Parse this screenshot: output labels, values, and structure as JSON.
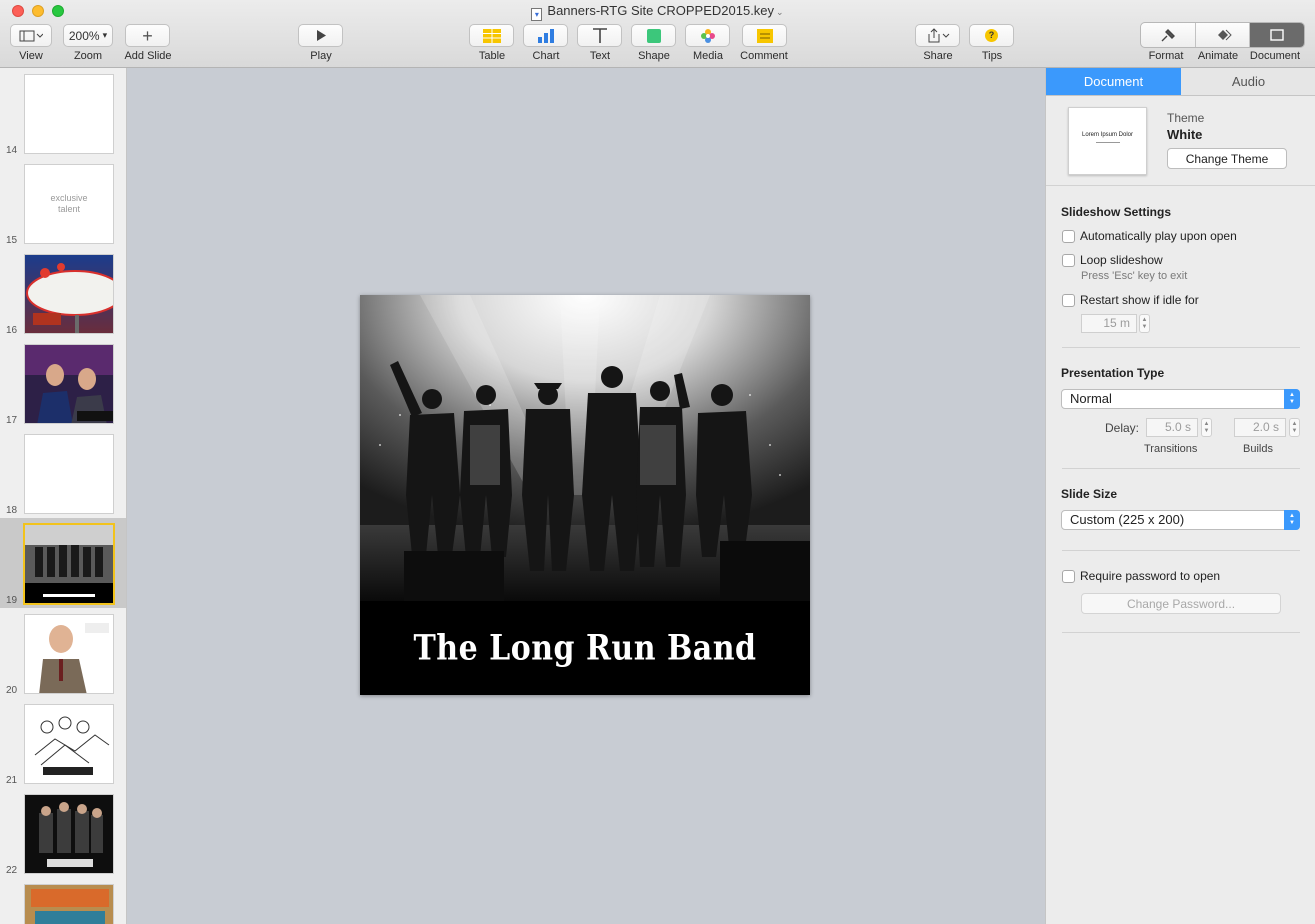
{
  "window": {
    "title": "Banners-RTG Site CROPPED2015.key"
  },
  "toolbar": {
    "view_label": "View",
    "zoom_label": "Zoom",
    "zoom_value": "200%",
    "add_slide_label": "Add Slide",
    "play_label": "Play",
    "table_label": "Table",
    "chart_label": "Chart",
    "text_label": "Text",
    "shape_label": "Shape",
    "media_label": "Media",
    "comment_label": "Comment",
    "share_label": "Share",
    "tips_label": "Tips",
    "format_label": "Format",
    "animate_label": "Animate",
    "document_label": "Document"
  },
  "navigator": {
    "slides": [
      {
        "number": "14",
        "text": ""
      },
      {
        "number": "15",
        "text": "exclusive talent"
      },
      {
        "number": "16",
        "text": ""
      },
      {
        "number": "17",
        "text": ""
      },
      {
        "number": "18",
        "text": ""
      },
      {
        "number": "19",
        "text": ""
      },
      {
        "number": "20",
        "text": ""
      },
      {
        "number": "21",
        "text": ""
      },
      {
        "number": "22",
        "text": ""
      }
    ],
    "selected": "19"
  },
  "slide": {
    "caption": "The Long Run Band"
  },
  "inspector": {
    "tabs": [
      "Document",
      "Audio"
    ],
    "active_tab": "Document",
    "theme_label": "Theme",
    "theme_name": "White",
    "theme_preview_text": "Lorem Ipsum Dolor",
    "change_theme_label": "Change Theme",
    "slideshow_heading": "Slideshow Settings",
    "autoplay_label": "Automatically play upon open",
    "loop_label": "Loop slideshow",
    "loop_hint": "Press 'Esc' key to exit",
    "restart_label": "Restart show if idle for",
    "idle_value": "15 m",
    "presentation_heading": "Presentation Type",
    "presentation_type": "Normal",
    "delay_label": "Delay:",
    "transitions_value": "5.0 s",
    "builds_value": "2.0 s",
    "transitions_label": "Transitions",
    "builds_label": "Builds",
    "slide_size_heading": "Slide Size",
    "slide_size": "Custom (225 x 200)",
    "password_label": "Require password to open",
    "change_password_label": "Change Password..."
  }
}
